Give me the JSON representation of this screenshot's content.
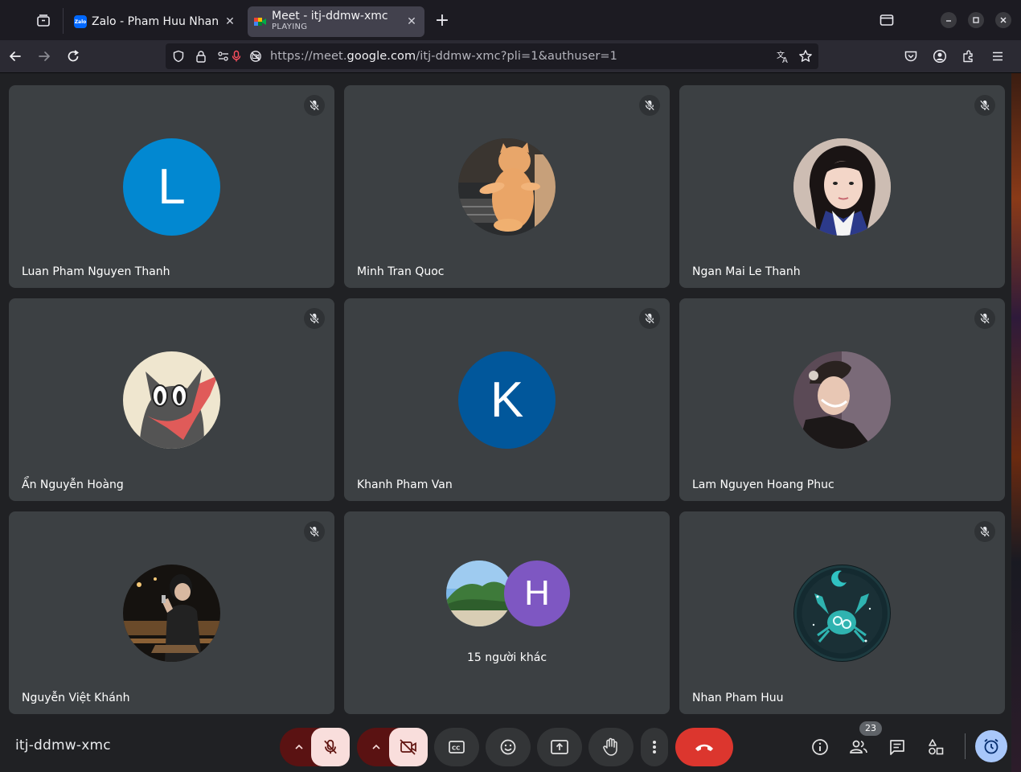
{
  "browser": {
    "tabs": [
      {
        "title": "Zalo - Pham Huu Nhan",
        "favicon": "Zalo",
        "active": false
      },
      {
        "title": "Meet - itj-ddmw-xmc",
        "subtitle": "PLAYING",
        "active": true
      }
    ],
    "url_prefix": "https://meet.",
    "url_host": "google.com",
    "url_path": "/itj-ddmw-xmc?pli=1&authuser=1"
  },
  "meeting": {
    "code": "itj-ddmw-xmc",
    "participant_count": "23",
    "tiles": [
      {
        "name": "Luan Pham Nguyen Thanh",
        "avatar_letter": "L",
        "avatar_color": "#0288d1",
        "muted": true
      },
      {
        "name": "Minh Tran Quoc",
        "avatar": "cat-photo",
        "muted": true
      },
      {
        "name": "Ngan Mai Le Thanh",
        "avatar": "person-photo",
        "muted": true
      },
      {
        "name": "Ẩn Nguyễn Hoàng",
        "avatar": "cartoon-cat-image",
        "muted": true
      },
      {
        "name": "Khanh Pham Van",
        "avatar_letter": "K",
        "avatar_color": "#01579b",
        "muted": true
      },
      {
        "name": "Lam Nguyen Hoang Phuc",
        "avatar": "person-photo",
        "muted": true
      },
      {
        "name": "Nguyễn Việt Khánh",
        "avatar": "person-photo",
        "muted": true
      },
      {
        "others_label": "15 người khác",
        "avatar_letter": "H",
        "avatar_color": "#7e57c2"
      },
      {
        "name": "Nhan Pham Huu",
        "avatar": "crab-emblem-image",
        "muted": true
      }
    ]
  },
  "colors": {
    "end_call": "#dc362e",
    "muted_control": "#f9dedc",
    "accent": "#a8c7fa"
  }
}
